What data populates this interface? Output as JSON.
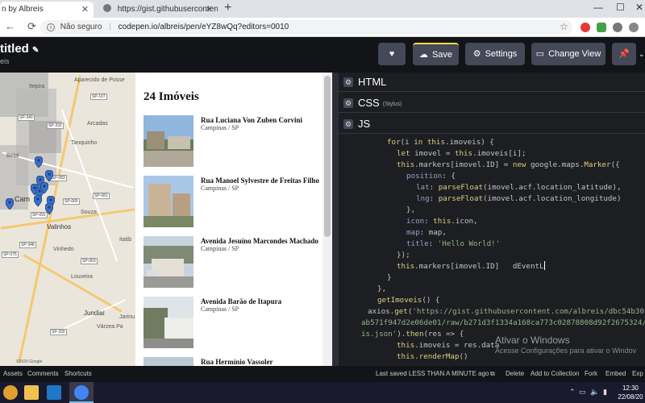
{
  "browser": {
    "tabs": [
      {
        "title": "n by Albreis",
        "active": true
      },
      {
        "title": "https://gist.githubusercontent.co",
        "active": false
      }
    ],
    "new_tab": "+",
    "security_label": "Não seguro",
    "url": "codepen.io/albreis/pen/eYZ8wQq?editors=0010"
  },
  "codepen": {
    "title": "titled",
    "owner": "eis",
    "buttons": {
      "save": "Save",
      "settings": "Settings",
      "change_view": "Change View"
    },
    "panels": [
      {
        "label": "HTML",
        "sub": ""
      },
      {
        "label": "CSS",
        "sub": "(Stylus)"
      },
      {
        "label": "JS",
        "sub": ""
      }
    ],
    "footer": {
      "assets": "Assets",
      "comments": "Comments",
      "shortcuts": "Shortcuts",
      "last_saved": "Last saved LESS THAN A MINUTE ago",
      "delete": "Delete",
      "add_to_collection": "Add to Collection",
      "fork": "Fork",
      "embed": "Embed",
      "export": "Exp"
    }
  },
  "preview": {
    "heading": "24 Imóveis",
    "items": [
      {
        "street": "Rua Luciana Von Zuben Corvini",
        "city": "Campinas / SP"
      },
      {
        "street": "Rua Manoel Sylvestre de Freitas Filho",
        "city": "Campinas / SP"
      },
      {
        "street": "Avenida Jesuíno Marcondes Machado",
        "city": "Campinas / SP"
      },
      {
        "street": "Avenida Barão de Itapura",
        "city": "Campinas / SP"
      },
      {
        "street": "Rua Hermínio Vassoler",
        "city": ""
      }
    ],
    "map": {
      "labels": [
        "Itepira",
        "Aparecido de Posse",
        "Arcadas",
        "Tanquinho",
        "Belal",
        "Souza",
        "Valinhos",
        "Vinhedo",
        "Itatib",
        "Louveira",
        "Jundiaí",
        "Várzea Pa",
        "Jarinu"
      ],
      "city_label": "Cam",
      "shields": [
        "SP-107",
        "SP-340",
        "SP-332",
        "SP-065",
        "SP-081",
        "SP-083",
        "SP-091",
        "SP-348",
        "SP-075",
        "SP-063",
        "SP-330"
      ],
      "copyright": "©2020 Google"
    }
  },
  "watermark": {
    "line1": "Ativar o Windows",
    "line2": "Acesse Configurações para ativar o Windov"
  },
  "taskbar": {
    "time": "12:30",
    "date": "22/08/20"
  },
  "colors": {
    "codepen_bg": "#131417",
    "button_bg": "#444857",
    "save_accent": "#ffdd40",
    "editor_bg": "#1d1e22",
    "pin_blue": "#3a70c9"
  }
}
